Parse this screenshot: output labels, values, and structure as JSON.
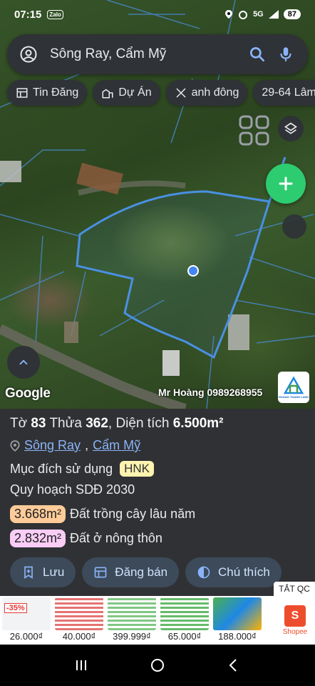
{
  "status_bar": {
    "time": "07:15",
    "app_badge": "Zalo",
    "network": "5G",
    "battery": "87"
  },
  "search": {
    "query": "Sông Ray, Cẩm Mỹ"
  },
  "chips": [
    {
      "label": "Tin Đăng",
      "icon": "list-icon"
    },
    {
      "label": "Dự Án",
      "icon": "buildings-icon"
    },
    {
      "label": "anh đông",
      "icon": "ruler-icon"
    },
    {
      "label": "29-64 Lâm",
      "icon": "none"
    }
  ],
  "map": {
    "google_logo": "Google",
    "watermark": "Mr Hoàng 0989268955",
    "brand_caption": "HOÀNG THANH LAND"
  },
  "parcel": {
    "title_prefix": "Tờ",
    "sheet_no": "83",
    "title_mid": "Thửa",
    "plot_no": "362",
    "area_label": ", Diện tích",
    "area": "6.500m²",
    "address_commune": "Sông Ray",
    "address_separator": ",",
    "address_district": "Cẩm Mỹ",
    "purpose_label": "Mục đích sử dụng",
    "purpose_code": "HNK",
    "plan_label": "Quy hoạch SDĐ 2030",
    "zones": [
      {
        "area": "3.668m²",
        "label": "Đất trồng cây lâu năm",
        "color": "#ffcc99"
      },
      {
        "area": "2.832m²",
        "label": "Đất ở nông thôn",
        "color": "#f9cdf5"
      }
    ]
  },
  "actions": [
    {
      "label": "Lưu",
      "icon": "bookmark-plus-icon"
    },
    {
      "label": "Đăng bán",
      "icon": "listing-icon"
    },
    {
      "label": "Chú thích",
      "icon": "contrast-icon"
    }
  ],
  "ad": {
    "close_label": "TẮT QC",
    "discount": "-35%",
    "prices": [
      "26.000₫",
      "40.000₫",
      "399.999₫",
      "65.000₫",
      "188.000₫"
    ],
    "shopee_label": "Shopee",
    "shopee_letter": "S"
  }
}
